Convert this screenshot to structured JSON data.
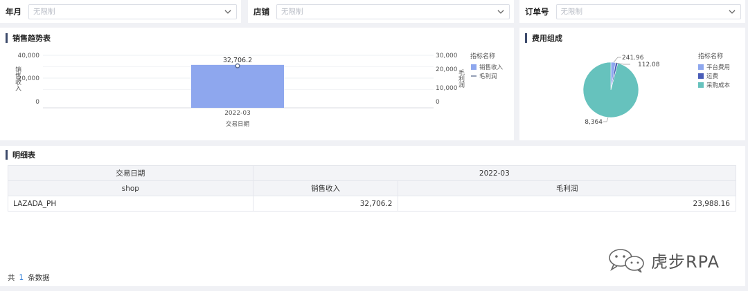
{
  "filters": [
    {
      "label": "年月",
      "placeholder": "无限制"
    },
    {
      "label": "店铺",
      "placeholder": "无限制"
    },
    {
      "label": "订单号",
      "placeholder": "无限制"
    }
  ],
  "trend": {
    "title": "销售趋势表",
    "chart_data": {
      "type": "bar",
      "categories": [
        "2022-03"
      ],
      "series": [
        {
          "name": "销售收入",
          "values": [
            32706.2
          ],
          "kind": "bar",
          "axis": "left",
          "color": "#8ea7ee"
        },
        {
          "name": "毛利润",
          "values": [
            23988.16
          ],
          "kind": "line",
          "axis": "right",
          "color": "#5b6b8f"
        }
      ],
      "xlabel": "交易日期",
      "ylabel_left": "销售收入",
      "ylabel_right": "毛利润",
      "ylim_left": [
        0,
        40000
      ],
      "ylim_right": [
        0,
        30000
      ],
      "yticks_left": [
        "40,000",
        "20,000",
        "0"
      ],
      "yticks_right": [
        "30,000",
        "20,000",
        "10,000",
        "0"
      ],
      "data_label": "32,706.2",
      "legend_title": "指标名称",
      "legend_position": "right",
      "grid": true
    }
  },
  "cost": {
    "title": "费用组成",
    "chart_data": {
      "type": "pie",
      "slices": [
        {
          "name": "平台费用",
          "value": 241.96,
          "label": "241.96",
          "color": "#8ea7ee"
        },
        {
          "name": "运费",
          "value": 112.08,
          "label": "112.08",
          "color": "#4a5db8"
        },
        {
          "name": "采购成本",
          "value": 8364,
          "label": "8,364",
          "color": "#66c2bd"
        }
      ],
      "legend_title": "指标名称",
      "legend_position": "right"
    }
  },
  "detail": {
    "title": "明细表",
    "header_row1": {
      "dim": "交易日期",
      "period": "2022-03"
    },
    "header_row2": {
      "dim": "shop",
      "col1": "销售收入",
      "col2": "毛利润"
    },
    "rows": [
      {
        "shop": "LAZADA_PH",
        "revenue": "32,706.2",
        "profit": "23,988.16"
      }
    ],
    "footer": {
      "prefix": "共",
      "count": "1",
      "suffix": "条数据"
    }
  },
  "watermark": {
    "text": "虎步RPA",
    "icon": "wechat-icon"
  }
}
